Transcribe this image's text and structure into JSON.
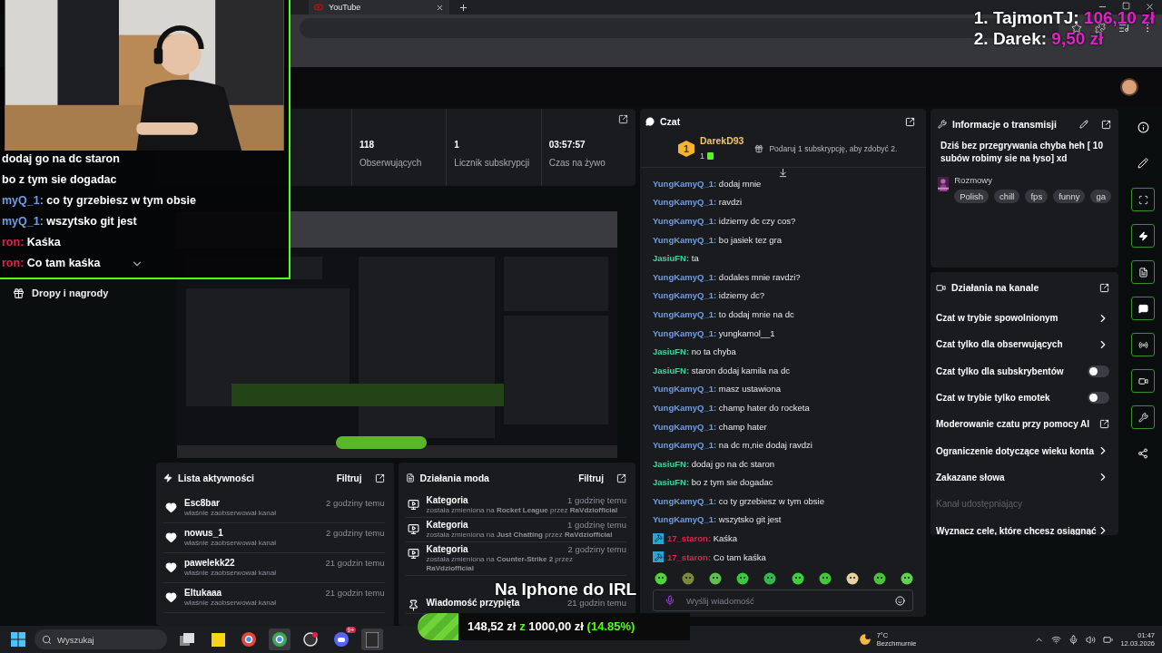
{
  "browser": {
    "tabs": [
      {
        "label": "YouTube"
      }
    ]
  },
  "leaderboard": [
    {
      "label": "1. TajmonTJ:",
      "amount": "106,10 zł"
    },
    {
      "label": "2. Darek:",
      "amount": "9,50 zł"
    }
  ],
  "webcam": {
    "overlay_chat": [
      {
        "text": "dodaj go na dc staron"
      },
      {
        "text": "bo z tym sie dogadac"
      },
      {
        "user": "myQ_1:",
        "color": "#6f9ee8",
        "text": "co ty grzebiesz w tym obsie"
      },
      {
        "user": "myQ_1:",
        "color": "#6f9ee8",
        "text": "wszytsko git jest"
      },
      {
        "user": "ron:",
        "color": "#e0234e",
        "text": "Kaśka"
      },
      {
        "user": "ron:",
        "color": "#e0234e",
        "text": "Co tam kaśka"
      }
    ]
  },
  "sidebar": {
    "items": [
      {
        "label": "Dropy i nagrody"
      }
    ]
  },
  "stats": [
    {
      "value": "118",
      "label": "Obserwujących"
    },
    {
      "value": "1",
      "label": "Licznik subskrypcji"
    },
    {
      "value": "03:57:57",
      "label": "Czas na żywo"
    }
  ],
  "activity": {
    "title": "Lista aktywności",
    "filter": "Filtruj",
    "items": [
      {
        "name": "Esc8bar",
        "time": "2 godziny temu",
        "text": "właśnie zaobserwował kanał"
      },
      {
        "name": "nowus_1",
        "time": "2 godziny temu",
        "text": "właśnie zaobserwował kanał"
      },
      {
        "name": "pawelekk22",
        "time": "21 godzin temu",
        "text": "właśnie zaobserwował kanał"
      },
      {
        "name": "Eltukaaa",
        "time": "21 godzin temu",
        "text": "właśnie zaobserwował kanał"
      }
    ]
  },
  "mod_actions": {
    "title": "Działania moda",
    "filter": "Filtruj",
    "items": [
      {
        "kind": "category",
        "title": "Kategoria",
        "time": "1 godzinę temu",
        "text": "została zmieniona na **Rocket League** przez **RaVdziofficial**"
      },
      {
        "kind": "category",
        "title": "Kategoria",
        "time": "1 godzinę temu",
        "text": "została zmieniona na **Just Chatting** przez **RaVdziofficial**"
      },
      {
        "kind": "category",
        "title": "Kategoria",
        "time": "2 godziny temu",
        "text": "została zmieniona na **Counter-Strike 2** przez **RaVdziofficial**"
      },
      {
        "kind": "pin",
        "title": "Wiadomość przypięta",
        "time": "21 godzin temu"
      }
    ]
  },
  "chat": {
    "title": "Czat",
    "top_gifter": {
      "rank": "1",
      "name": "DarekD93",
      "count": "1",
      "hint": "Podaruj 1 subskrypcję, aby zdobyć 2."
    },
    "messages": [
      {
        "kind": "plain",
        "user": "YungKamyQ_1:",
        "color": "#6f9ee8",
        "text": "dodaj mnie"
      },
      {
        "kind": "plain",
        "user": "YungKamyQ_1:",
        "color": "#6f9ee8",
        "text": "ravdzi"
      },
      {
        "kind": "plain",
        "user": "YungKamyQ_1:",
        "color": "#6f9ee8",
        "text": "idziemy dc czy cos?"
      },
      {
        "kind": "plain",
        "user": "YungKamyQ_1:",
        "color": "#6f9ee8",
        "text": "bo jasiek tez gra"
      },
      {
        "kind": "plain",
        "user": "JasiuFN:",
        "color": "#3fd39c",
        "text": "ta"
      },
      {
        "kind": "plain",
        "user": "YungKamyQ_1:",
        "color": "#6f9ee8",
        "text": "dodales mnie ravdzi?"
      },
      {
        "kind": "plain",
        "user": "YungKamyQ_1:",
        "color": "#6f9ee8",
        "text": "idziemy dc?"
      },
      {
        "kind": "plain",
        "user": "YungKamyQ_1:",
        "color": "#6f9ee8",
        "text": "to dodaj mnie na dc"
      },
      {
        "kind": "plain",
        "user": "YungKamyQ_1:",
        "color": "#6f9ee8",
        "text": "yungkamol__1"
      },
      {
        "kind": "plain",
        "user": "JasiuFN:",
        "color": "#3fd39c",
        "text": "no ta chyba"
      },
      {
        "kind": "plain",
        "user": "JasiuFN:",
        "color": "#3fd39c",
        "text": "staron dodaj kamila na dc"
      },
      {
        "kind": "plain",
        "user": "YungKamyQ_1:",
        "color": "#6f9ee8",
        "text": "masz ustawiona"
      },
      {
        "kind": "plain",
        "user": "YungKamyQ_1:",
        "color": "#6f9ee8",
        "text": "champ hater do rocketa"
      },
      {
        "kind": "plain",
        "user": "YungKamyQ_1:",
        "color": "#6f9ee8",
        "text": "champ hater"
      },
      {
        "kind": "plain",
        "user": "YungKamyQ_1:",
        "color": "#6f9ee8",
        "text": "na dc m,nie dodaj ravdzi"
      },
      {
        "kind": "plain",
        "user": "JasiuFN:",
        "color": "#3fd39c",
        "text": "dodaj go na dc staron"
      },
      {
        "kind": "plain",
        "user": "JasiuFN:",
        "color": "#3fd39c",
        "text": "bo z tym sie dogadac"
      },
      {
        "kind": "plain",
        "user": "YungKamyQ_1:",
        "color": "#6f9ee8",
        "text": "co ty grzebiesz w tym obsie"
      },
      {
        "kind": "plain",
        "user": "YungKamyQ_1:",
        "color": "#6f9ee8",
        "text": "wszytsko git jest"
      },
      {
        "kind": "mod",
        "user": "17_staron:",
        "color": "#e0234e",
        "text": "Kaśka"
      },
      {
        "kind": "mod",
        "user": "17_staron:",
        "color": "#e0234e",
        "text": "Co tam kaśka"
      }
    ],
    "placeholder": "Wyślij wiadomość"
  },
  "stream_info": {
    "title": "Informacje o transmisji",
    "description": "Dziś bez przegrywania chyba heh [ 10 subów robimy sie na łyso] xd",
    "category": "Rozmowy",
    "tags": [
      "Polish",
      "chill",
      "fps",
      "funny",
      "ga"
    ]
  },
  "channel_actions": {
    "title": "Działania na kanale",
    "items": [
      {
        "kind": "link",
        "label": "Czat w trybie spowolnionym"
      },
      {
        "kind": "link",
        "label": "Czat tylko dla obserwujących"
      },
      {
        "kind": "toggle",
        "label": "Czat tylko dla subskrybentów",
        "on": false
      },
      {
        "kind": "toggle",
        "label": "Czat w trybie tylko emotek",
        "on": false
      },
      {
        "kind": "external",
        "label": "Moderowanie czatu przy pomocy AI"
      },
      {
        "kind": "link",
        "label": "Ograniczenie dotyczące wieku konta"
      },
      {
        "kind": "link",
        "label": "Zakazane słowa"
      },
      {
        "kind": "section",
        "label": "Kanał udostępniający"
      },
      {
        "kind": "link",
        "label": "Wyznacz cele, które chcesz osiągnąć"
      }
    ]
  },
  "goal": {
    "title": "Na Iphone do IRL",
    "current": "148,52 zł",
    "separator": "z",
    "target": "1000,00 zł",
    "percent": "(14.85%)",
    "level": 0.1485
  },
  "taskbar": {
    "search_placeholder": "Wyszukaj",
    "discord_badge": "9+",
    "weather": {
      "temp": "7°C",
      "condition": "Bezchmurnie"
    },
    "time": "01:47",
    "date": "12.03.2026"
  }
}
